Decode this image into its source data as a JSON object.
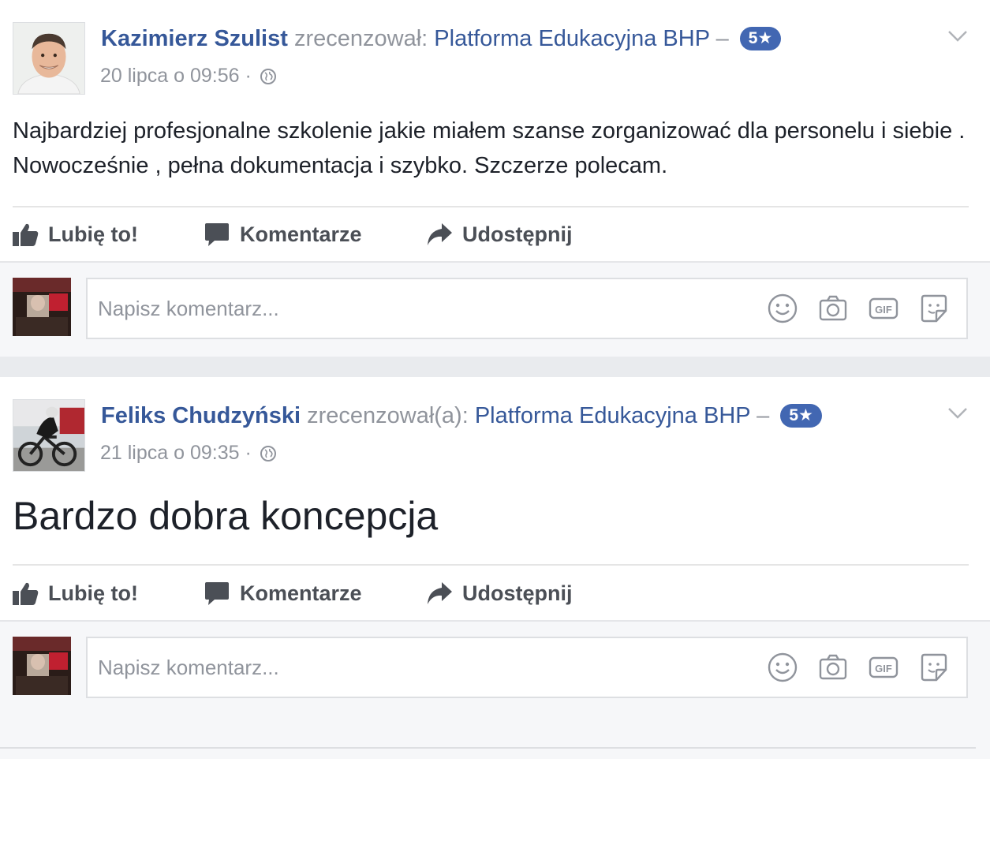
{
  "posts": [
    {
      "author": "Kazimierz Szulist",
      "verb": "zrecenzował:",
      "page": "Platforma Edukacyjna BHP",
      "dash": "–",
      "rating": "5★",
      "time": "20 lipca o 09:56 ·",
      "text": "Najbardziej profesjonalne szkolenie jakie miałem szanse zorganizować dla personelu i siebie . Nowocześnie , pełna dokumentacja i szybko. Szczerze polecam."
    },
    {
      "author": "Feliks Chudzyński",
      "verb": "zrecenzował(a):",
      "page": "Platforma Edukacyjna BHP",
      "dash": "–",
      "rating": "5★",
      "time": "21 lipca o 09:35 ·",
      "text": "Bardzo dobra koncepcja"
    }
  ],
  "actions": {
    "like": "Lubię to!",
    "comment": "Komentarze",
    "share": "Udostępnij"
  },
  "comment_box": {
    "placeholder": "Napisz komentarz..."
  },
  "colors": {
    "link": "#365899",
    "meta": "#90949c",
    "rating_badge": "#4267b2",
    "action_text": "#4b4f56"
  },
  "icons": [
    "thumbs-up-icon",
    "comment-bubble-icon",
    "share-arrow-icon",
    "globe-icon",
    "chevron-down-icon",
    "emoji-icon",
    "camera-icon",
    "gif-icon",
    "sticker-icon"
  ]
}
